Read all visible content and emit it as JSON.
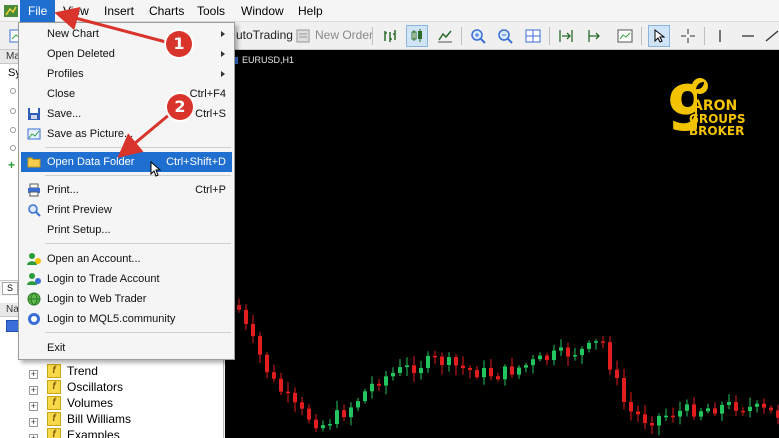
{
  "menubar": {
    "items": [
      "File",
      "View",
      "Insert",
      "Charts",
      "Tools",
      "Window",
      "Help"
    ]
  },
  "toolbar": {
    "auto_trading": "utoTrading",
    "new_order": "New Order"
  },
  "left_panel": {
    "market_watch_title": "Ma",
    "symbol_header": "Sy",
    "navigator_title": "Na",
    "tree_items": [
      "Trend",
      "Oscillators",
      "Volumes",
      "Bill Williams",
      "Examples"
    ]
  },
  "file_menu": {
    "items": [
      {
        "label": "New Chart",
        "shortcut": "",
        "submenu": true
      },
      {
        "label": "Open Deleted",
        "shortcut": "",
        "submenu": true
      },
      {
        "label": "Profiles",
        "shortcut": "",
        "submenu": true
      },
      {
        "label": "Close",
        "shortcut": "Ctrl+F4",
        "submenu": false
      },
      {
        "label": "Save...",
        "shortcut": "Ctrl+S",
        "submenu": false
      },
      {
        "label": "Save as Picture...",
        "shortcut": "",
        "submenu": false
      },
      {
        "label": "Open Data Folder",
        "shortcut": "Ctrl+Shift+D",
        "submenu": false
      },
      {
        "label": "Print...",
        "shortcut": "Ctrl+P",
        "submenu": false
      },
      {
        "label": "Print Preview",
        "shortcut": "",
        "submenu": false
      },
      {
        "label": "Print Setup...",
        "shortcut": "",
        "submenu": false
      },
      {
        "label": "Open an Account...",
        "shortcut": "",
        "submenu": false
      },
      {
        "label": "Login to Trade Account",
        "shortcut": "",
        "submenu": false
      },
      {
        "label": "Login to Web Trader",
        "shortcut": "",
        "submenu": false
      },
      {
        "label": "Login to MQL5.community",
        "shortcut": "",
        "submenu": false
      },
      {
        "label": "Exit",
        "shortcut": "",
        "submenu": false
      }
    ]
  },
  "chart": {
    "symbol": "EURUSD,H1",
    "bull_color": "#22c55e",
    "bear_color": "#e11d1d"
  },
  "logo": {
    "digit": "9",
    "line1": "ARON",
    "line2": "GROUPS",
    "line3": "BROKER",
    "color": "#f4c300"
  },
  "annotations": {
    "step1": "1",
    "step2": "2",
    "color": "#d9342b"
  },
  "icons": {
    "save": "floppy-disk-icon",
    "save_picture": "picture-icon",
    "open_folder": "folder-icon",
    "print": "printer-icon",
    "print_preview": "magnifier-icon",
    "account": "user-icon",
    "trade_login": "user-key-icon",
    "web_trader": "globe-icon",
    "mql5": "mql5-icon"
  }
}
